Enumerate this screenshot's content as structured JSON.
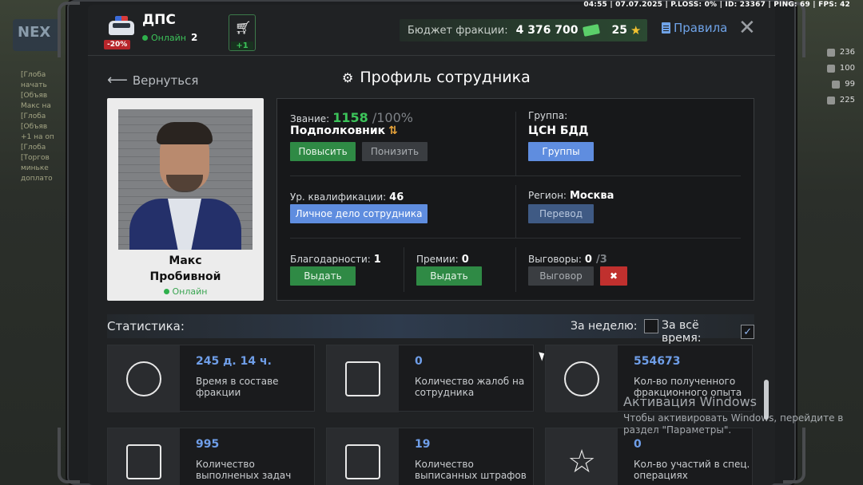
{
  "system_bar": "04:55 | 07.07.2025 | P.LOSS: 0% | ID: 23367 | PING: 69 | FPS: 42",
  "background": {
    "logo": "NEX",
    "chat_lines": [
      "[Глоба",
      "начать",
      "[Объяв",
      "Макс на",
      "[Глоба",
      "[Объяв",
      "+1 на оп",
      "[Глоба",
      "[Торгов",
      "миньке",
      "доплато"
    ],
    "hud_stats": [
      "236",
      "100",
      "99",
      "225"
    ]
  },
  "header": {
    "faction_name": "ДПС",
    "discount": "-20%",
    "online_label": "Онлайн",
    "online_count": "2",
    "cart_badge": "+1",
    "budget_label": "Бюджет фракции:",
    "budget_value": "4 376 700",
    "stars_value": "25",
    "rules_label": "Правила"
  },
  "nav": {
    "back_label": "Вернуться",
    "page_title": "Профиль сотрудника"
  },
  "employee": {
    "first_name": "Макс",
    "last_name": "Пробивной",
    "status": "Онлайн"
  },
  "info": {
    "rank_label": "Звание:",
    "rank_progress": "1158",
    "rank_progress_max": "/100%",
    "rank_name": "Подполковник",
    "promote_btn": "Повысить",
    "demote_btn": "Понизить",
    "group_label": "Группа:",
    "group_value": "ЦСН БДД",
    "groups_btn": "Группы",
    "qualification_label": "Ур. квалификации:",
    "qualification_value": "46",
    "personal_file_btn": "Личное дело сотрудника",
    "region_label": "Регион:",
    "region_value": "Москва",
    "transfer_btn": "Перевод",
    "thanks_label": "Благодарности:",
    "thanks_value": "1",
    "thanks_btn": "Выдать",
    "bonus_label": "Премии:",
    "bonus_value": "0",
    "bonus_btn": "Выдать",
    "reprimand_label": "Выговоры:",
    "reprimand_value": "0",
    "reprimand_max": "/3",
    "reprimand_btn": "Выговор"
  },
  "stats": {
    "title": "Статистика:",
    "week_label": "За неделю:",
    "alltime_label": "За всё время:",
    "week_checked": false,
    "alltime_checked": true,
    "cards": [
      {
        "value": "245 д. 14 ч.",
        "desc": "Время в составе фракции",
        "icon": "stopwatch-icon"
      },
      {
        "value": "0",
        "desc": "Количество жалоб на сотрудника",
        "icon": "complaint-doc-icon"
      },
      {
        "value": "554673",
        "desc": "Кол-во полученного фракционного опыта",
        "icon": "exp-stars-icon"
      },
      {
        "value": "995",
        "desc": "Количество выполненых задач",
        "icon": "clipboard-checklist-icon"
      },
      {
        "value": "19",
        "desc": "Количество выписанных штрафов",
        "icon": "fine-ruble-doc-icon"
      },
      {
        "value": "0",
        "desc": "Кол-во участий в спец. операциях",
        "icon": "star-waves-icon"
      }
    ]
  },
  "watermark": {
    "title": "Активация Windows",
    "text": "Чтобы активировать Windows, перейдите в раздел \"Параметры\"."
  },
  "colors": {
    "accent_green": "#2f8a45",
    "accent_blue": "#5f8ddf",
    "value_blue": "#6f9ee8",
    "danger_red": "#c0302e"
  }
}
